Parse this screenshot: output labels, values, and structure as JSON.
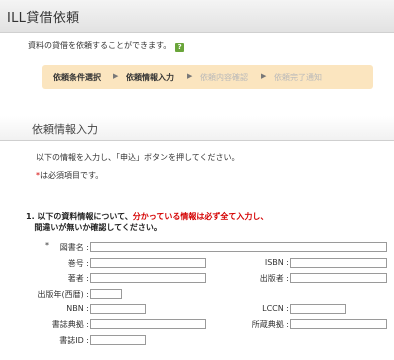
{
  "page": {
    "title": "ILL貸借依頼",
    "intro": "資料の貸借を依頼することができます。",
    "help_icon_text": "?"
  },
  "steps": [
    {
      "label": "依頼条件選択",
      "state": "active"
    },
    {
      "label": "依頼情報入力",
      "state": "active"
    },
    {
      "label": "依頼内容確認",
      "state": "inactive"
    },
    {
      "label": "依頼完了通知",
      "state": "inactive"
    }
  ],
  "step_separator": "▶",
  "section": {
    "title": "依頼情報入力",
    "instruction": "以下の情報を入力し、「申込」ボタンを押してください。",
    "required_mark": "*",
    "required_note": "は必須項目です。"
  },
  "question": {
    "number": "1.",
    "text_a": "以下の資料情報について、",
    "text_emphasis": "分かっている情報は必ず全て入力し、",
    "text_b": "間違いが無いか確認してください。"
  },
  "fields": {
    "book_title": {
      "label": "図書名 :",
      "value": ""
    },
    "volume": {
      "label": "巻号 :",
      "value": ""
    },
    "isbn": {
      "label": "ISBN :",
      "value": ""
    },
    "author": {
      "label": "著者 :",
      "value": ""
    },
    "publisher": {
      "label": "出版者 :",
      "value": ""
    },
    "pub_year": {
      "label": "出版年(西暦) :",
      "value": ""
    },
    "nbn": {
      "label": "NBN :",
      "value": ""
    },
    "lccn": {
      "label": "LCCN :",
      "value": ""
    },
    "biblio_source": {
      "label": "書誌典拠 :",
      "value": ""
    },
    "holding_source": {
      "label": "所蔵典拠 :",
      "value": ""
    },
    "biblio_id": {
      "label": "書誌ID :",
      "value": ""
    }
  },
  "colors": {
    "step_bar": "#fbe5bf",
    "required": "#d40000",
    "help_icon": "#6aa53a"
  }
}
